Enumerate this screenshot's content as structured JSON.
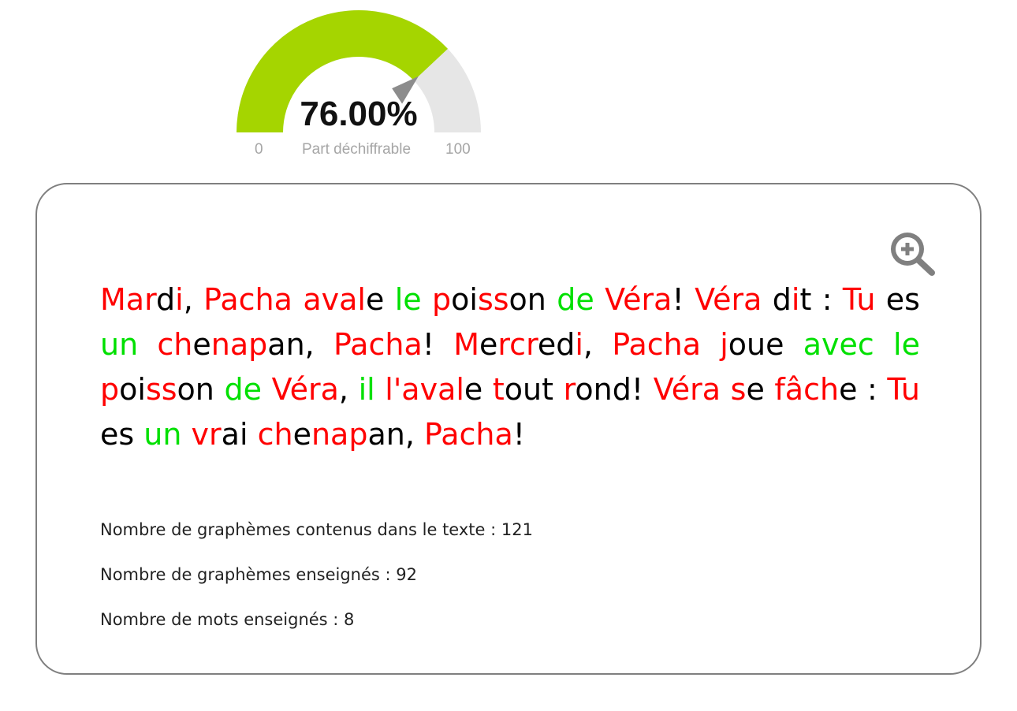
{
  "gauge": {
    "value_text": "76.00%",
    "value": 76,
    "min_label": "0",
    "max_label": "100",
    "label": "Part déchiffrable",
    "colors": {
      "fill": "#a5d500",
      "track": "#e6e6e6",
      "needle": "#8c8c8c"
    }
  },
  "text": {
    "colors": {
      "red": "#ff0000",
      "green": "#00e000",
      "black": "#000000"
    },
    "segments": [
      [
        "Mar",
        "r"
      ],
      [
        "d",
        "k"
      ],
      [
        "i",
        "r"
      ],
      [
        ", ",
        "k"
      ],
      [
        "Pacha",
        "r"
      ],
      [
        " ",
        "k"
      ],
      [
        "aval",
        "r"
      ],
      [
        "e ",
        "k"
      ],
      [
        "le",
        "g"
      ],
      [
        " ",
        "k"
      ],
      [
        "p",
        "r"
      ],
      [
        "oi",
        "k"
      ],
      [
        "ss",
        "r"
      ],
      [
        "on ",
        "k"
      ],
      [
        "de",
        "g"
      ],
      [
        " ",
        "k"
      ],
      [
        "Véra",
        "r"
      ],
      [
        "! ",
        "k"
      ],
      [
        "Véra",
        "r"
      ],
      [
        " d",
        "k"
      ],
      [
        "i",
        "r"
      ],
      [
        "t : ",
        "k"
      ],
      [
        "Tu",
        "r"
      ],
      [
        " es ",
        "k"
      ],
      [
        "un",
        "g"
      ],
      [
        " ",
        "k"
      ],
      [
        "ch",
        "r"
      ],
      [
        "e",
        "k"
      ],
      [
        "nap",
        "r"
      ],
      [
        "an, ",
        "k"
      ],
      [
        "Pacha",
        "r"
      ],
      [
        "! ",
        "k"
      ],
      [
        "M",
        "r"
      ],
      [
        "e",
        "k"
      ],
      [
        "rcr",
        "r"
      ],
      [
        "ed",
        "k"
      ],
      [
        "i",
        "r"
      ],
      [
        ", ",
        "k"
      ],
      [
        "Pacha",
        "r"
      ],
      [
        " ",
        "k"
      ],
      [
        "j",
        "r"
      ],
      [
        "oue ",
        "k"
      ],
      [
        "avec le",
        "g"
      ],
      [
        " ",
        "k"
      ],
      [
        "p",
        "r"
      ],
      [
        "oi",
        "k"
      ],
      [
        "ss",
        "r"
      ],
      [
        "on ",
        "k"
      ],
      [
        "de",
        "g"
      ],
      [
        " ",
        "k"
      ],
      [
        "Véra",
        "r"
      ],
      [
        ", ",
        "k"
      ],
      [
        "il",
        "g"
      ],
      [
        " ",
        "k"
      ],
      [
        "l'aval",
        "r"
      ],
      [
        "e ",
        "k"
      ],
      [
        "t",
        "r"
      ],
      [
        "out ",
        "k"
      ],
      [
        "r",
        "r"
      ],
      [
        "ond! ",
        "k"
      ],
      [
        "Véra",
        "r"
      ],
      [
        " ",
        "k"
      ],
      [
        "s",
        "r"
      ],
      [
        "e ",
        "k"
      ],
      [
        "fâch",
        "r"
      ],
      [
        "e : ",
        "k"
      ],
      [
        "Tu",
        "r"
      ],
      [
        " es ",
        "k"
      ],
      [
        "un",
        "g"
      ],
      [
        " ",
        "k"
      ],
      [
        "vr",
        "r"
      ],
      [
        "ai ",
        "k"
      ],
      [
        "ch",
        "r"
      ],
      [
        "e",
        "k"
      ],
      [
        "nap",
        "r"
      ],
      [
        "an, ",
        "k"
      ],
      [
        "Pacha",
        "r"
      ],
      [
        "!",
        "k"
      ]
    ]
  },
  "stats": {
    "graphemes_total": "Nombre de graphèmes contenus dans le texte : 121",
    "graphemes_taught": "Nombre de graphèmes enseignés : 92",
    "words_taught": "Nombre de mots enseignés : 8"
  },
  "icons": {
    "zoom": "zoom-in-icon"
  }
}
